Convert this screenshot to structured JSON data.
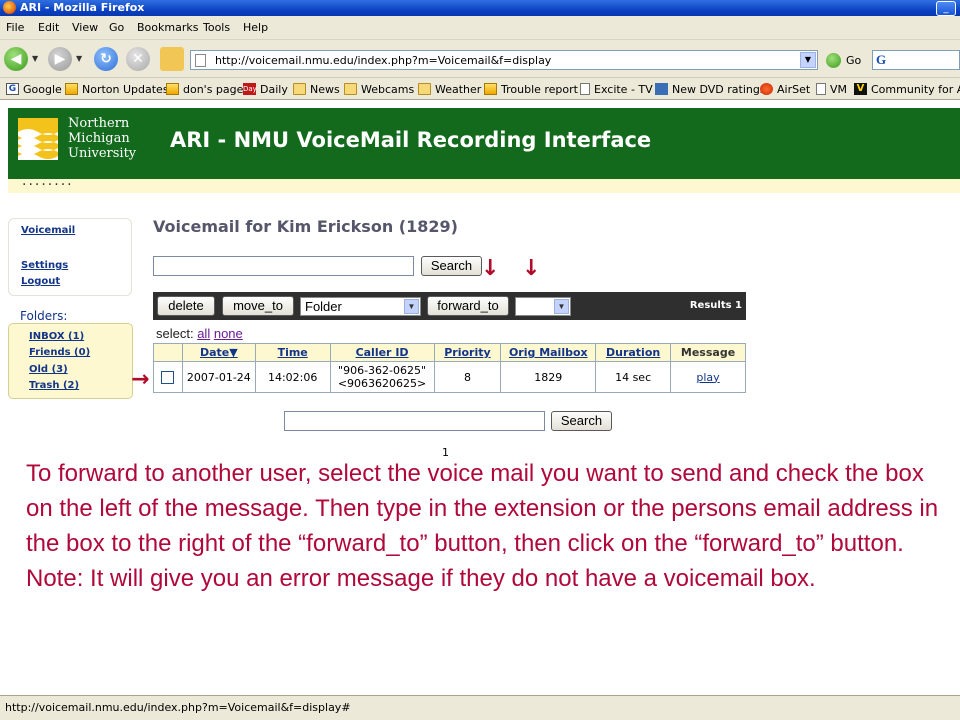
{
  "window": {
    "title": "ARI - Mozilla Firefox"
  },
  "menu": [
    "File",
    "Edit",
    "View",
    "Go",
    "Bookmarks",
    "Tools",
    "Help"
  ],
  "nav": {
    "url": "http://voicemail.nmu.edu/index.php?m=Voicemail&f=display",
    "go_label": "Go"
  },
  "bookmarks": [
    {
      "label": "Google",
      "icon": "google-icon"
    },
    {
      "label": "Norton Updates",
      "icon": "norton-icon"
    },
    {
      "label": "don's page",
      "icon": "norton-icon"
    },
    {
      "label": "Daily",
      "icon": "day-icon"
    },
    {
      "label": "News",
      "icon": "folder-icon"
    },
    {
      "label": "Webcams",
      "icon": "folder-icon"
    },
    {
      "label": "Weather",
      "icon": "folder-icon"
    },
    {
      "label": "Trouble report",
      "icon": "norton-icon"
    },
    {
      "label": "Excite - TV",
      "icon": "page-icon"
    },
    {
      "label": "New DVD ratings",
      "icon": "excite-icon"
    },
    {
      "label": "AirSet",
      "icon": "airset-icon"
    },
    {
      "label": "VM",
      "icon": "page-icon"
    },
    {
      "label": "Community for Ava",
      "icon": "v-icon"
    }
  ],
  "header": {
    "logo_lines": [
      "Northern",
      "Michigan",
      "University"
    ],
    "title": "ARI - NMU VoiceMail Recording Interface",
    "dots": "........"
  },
  "sidebar": {
    "voicemail": "Voicemail",
    "settings": "Settings",
    "logout": "Logout",
    "folders_label": "Folders:",
    "folders": [
      "INBOX (1)",
      "Friends (0)",
      "Old (3)",
      "Trash (2)"
    ]
  },
  "main": {
    "heading": "Voicemail for Kim Erickson (1829)",
    "search_button": "Search",
    "delete_button": "delete",
    "move_to_button": "move_to",
    "folder_select": "Folder",
    "forward_to_button": "forward_to",
    "forward_select": "",
    "results": "Results 1",
    "select_label": "select:",
    "select_all": "all",
    "select_none": "none",
    "columns": [
      "Date",
      "Time",
      "Caller ID",
      "Priority",
      "Orig Mailbox",
      "Duration",
      "Message"
    ],
    "rows": [
      {
        "date": "2007-01-24",
        "time": "14:02:06",
        "caller_line1": "\"906-362-0625\"",
        "caller_line2": "<9063620625>",
        "priority": "8",
        "orig_mailbox": "1829",
        "duration": "14 sec",
        "message": "play"
      }
    ],
    "search_button_bottom": "Search",
    "page_number": "1"
  },
  "instructions": {
    "paragraph1": "To forward to another user, select the voice mail you want to send and check the box on the left of the message.   Then type in the extension or the persons email address in the box to the right of the “forward_to” button, then click on the “forward_to” button.",
    "paragraph2": "Note: It will give you an error message if they do not have a voicemail box."
  },
  "status": {
    "text": "http://voicemail.nmu.edu/index.php?m=Voicemail&f=display#"
  },
  "colors": {
    "header_green": "#136a1d",
    "accent_cream": "#fdf8cf",
    "instruction_red": "#b0083a",
    "link_blue": "#12358a"
  }
}
